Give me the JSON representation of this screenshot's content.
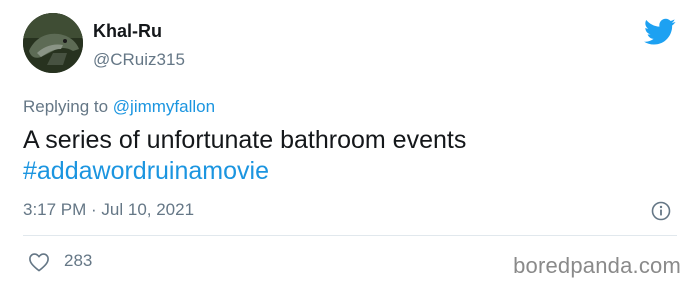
{
  "tweet": {
    "display_name": "Khal-Ru",
    "handle": "@CRuiz315",
    "reply_prefix": "Replying to",
    "reply_to": "@jimmyfallon",
    "text": "A series of unfortunate bathroom events",
    "hashtag": "#addawordruinamovie",
    "timestamp": "3:17 PM · Jul 10, 2021",
    "like_count": "283"
  },
  "watermark": "boredpanda.com",
  "colors": {
    "twitter_blue": "#1da1f2",
    "link_blue": "#1b95e0",
    "secondary_text": "#657786",
    "divider": "#e1e8ed"
  },
  "icons": {
    "brand": "twitter-bird-icon",
    "info": "info-icon",
    "like": "heart-icon"
  }
}
